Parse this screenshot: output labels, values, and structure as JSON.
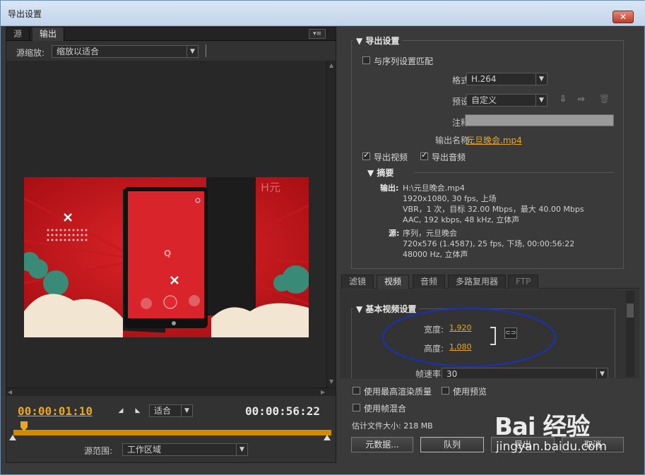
{
  "window": {
    "title": "导出设置",
    "close_label": "✕"
  },
  "left_panel": {
    "tabs": [
      {
        "label": "源",
        "active": false
      },
      {
        "label": "输出",
        "active": true
      }
    ],
    "panel_menu_icon": "panel-menu-icon",
    "source_scale_label": "源缩放:",
    "source_scale_value": "缩放以适合",
    "video_overlay_text": "H元",
    "current_time": "00:00:01:10",
    "end_time": "00:00:56:22",
    "fit_value": "适合",
    "source_range_label": "源范围:",
    "source_range_value": "工作区域"
  },
  "export_settings": {
    "title": "导出设置",
    "match_sequence_label": "与序列设置匹配",
    "match_sequence_checked": false,
    "format_label": "格式:",
    "format_value": "H.264",
    "preset_label": "预设:",
    "preset_value": "自定义",
    "comment_label": "注释:",
    "comment_value": "",
    "output_name_label": "输出名称:",
    "output_name_value": "元旦晚会.mp4",
    "export_video_label": "导出视频",
    "export_video_checked": true,
    "export_audio_label": "导出音频",
    "export_audio_checked": true
  },
  "summary": {
    "title": "摘要",
    "output_label": "输出:",
    "output_lines": [
      "H:\\元旦晚会.mp4",
      "1920x1080, 30 fps, 上场",
      "VBR，1 次，目标 32.00 Mbps，最大 40.00  Mbps",
      "AAC, 192 kbps, 48 kHz, 立体声"
    ],
    "source_label": "源:",
    "source_lines": [
      "序列，元旦晚会",
      "720x576 (1.4587), 25 fps, 下场, 00:00:56:22",
      "48000 Hz, 立体声"
    ]
  },
  "settings_tabs": [
    {
      "label": "滤镜",
      "active": false,
      "disabled": false
    },
    {
      "label": "视频",
      "active": true,
      "disabled": false
    },
    {
      "label": "音频",
      "active": false,
      "disabled": false
    },
    {
      "label": "多路复用器",
      "active": false,
      "disabled": false
    },
    {
      "label": "FTP",
      "active": false,
      "disabled": true
    }
  ],
  "basic_video": {
    "title": "基本视频设置",
    "width_label": "宽度:",
    "width_value": "1,920",
    "height_label": "高度:",
    "height_value": "1,080",
    "frame_rate_label": "帧速率:",
    "frame_rate_value": "30"
  },
  "bottom": {
    "max_render_quality_label": "使用最高渲染质量",
    "use_preview_label": "使用预览",
    "frame_blending_label": "使用帧混合",
    "estimated_size": "估计文件大小: 218 MB",
    "metadata_button": "元数据...",
    "queue_button": "队列",
    "export_button": "导出",
    "cancel_button": "取消"
  },
  "watermark": {
    "logo": "Bai 经验",
    "url": "jingyan.baidu.com"
  },
  "colors": {
    "accent": "#e8a621",
    "annotation_ellipse": "#1532c8"
  }
}
